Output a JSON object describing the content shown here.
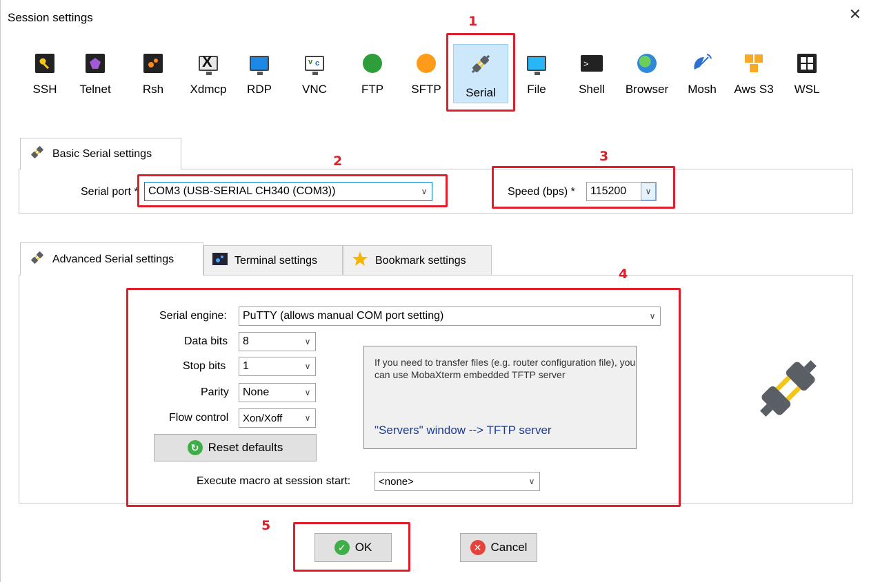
{
  "window": {
    "title": "Session settings",
    "close_label": "✕"
  },
  "toolbar": {
    "items": [
      {
        "label": "SSH"
      },
      {
        "label": "Telnet"
      },
      {
        "label": "Rsh"
      },
      {
        "label": "Xdmcp"
      },
      {
        "label": "RDP"
      },
      {
        "label": "VNC"
      },
      {
        "label": "FTP"
      },
      {
        "label": "SFTP"
      },
      {
        "label": "Serial",
        "selected": true
      },
      {
        "label": "File"
      },
      {
        "label": "Shell"
      },
      {
        "label": "Browser"
      },
      {
        "label": "Mosh"
      },
      {
        "label": "Aws S3"
      },
      {
        "label": "WSL"
      }
    ]
  },
  "basic": {
    "tab_label": "Basic Serial settings",
    "serial_port_label": "Serial port *",
    "serial_port_value": "COM3  (USB-SERIAL CH340 (COM3))",
    "speed_label": "Speed (bps) *",
    "speed_value": "115200"
  },
  "advanced": {
    "tabs": [
      {
        "label": "Advanced Serial settings",
        "active": true
      },
      {
        "label": "Terminal settings",
        "active": false
      },
      {
        "label": "Bookmark settings",
        "active": false
      }
    ],
    "serial_engine_label": "Serial engine:",
    "serial_engine_value": "PuTTY    (allows manual COM port setting)",
    "data_bits_label": "Data bits",
    "data_bits_value": "8",
    "stop_bits_label": "Stop bits",
    "stop_bits_value": "1",
    "parity_label": "Parity",
    "parity_value": "None",
    "flow_control_label": "Flow control",
    "flow_control_value": "Xon/Xoff",
    "reset_label": "Reset defaults",
    "macro_label": "Execute macro at session start:",
    "macro_value": "<none>",
    "info_text": "If you need to transfer files (e.g. router configuration file), you can use MobaXterm embedded TFTP server",
    "info_link": "\"Servers\" window  -->  TFTP server"
  },
  "footer": {
    "ok_label": "OK",
    "cancel_label": "Cancel"
  },
  "annotations": [
    "1",
    "2",
    "3",
    "4",
    "5"
  ],
  "colors": {
    "annotation": "#e01e2b",
    "selected_bg": "#cde8fb",
    "link": "#1a3a9c"
  }
}
